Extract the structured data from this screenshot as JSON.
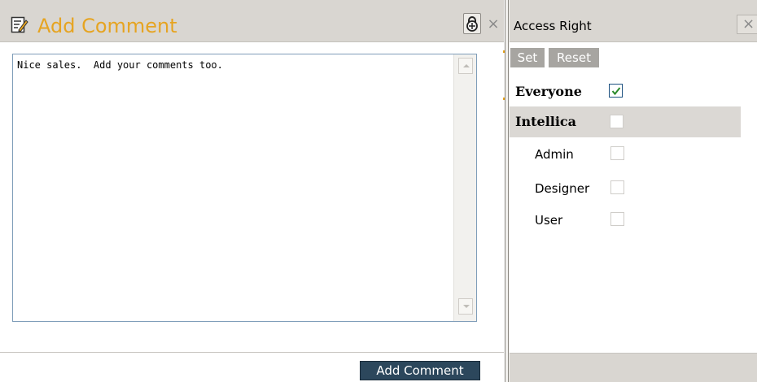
{
  "comment_panel": {
    "title": "Add Comment",
    "icon": "edit-note-icon",
    "lock_icon": "lock-icon",
    "close_label": "×",
    "comment_text": "Nice sales.  Add your comments too.",
    "submit_label": "Add Comment"
  },
  "access_panel": {
    "title": "Access Right",
    "close_label": "×",
    "set_label": "Set",
    "reset_label": "Reset",
    "rights": [
      {
        "label": "Everyone",
        "checked": true,
        "bold": true
      },
      {
        "label": "Intellica",
        "checked": false,
        "bold": true
      },
      {
        "label": "Admin",
        "checked": false,
        "bold": false
      },
      {
        "label": "Designer",
        "checked": false,
        "bold": false
      },
      {
        "label": "User",
        "checked": false,
        "bold": false
      }
    ]
  },
  "colors": {
    "title_accent": "#e6a421",
    "titlebar_bg": "#d9d6d1",
    "submit_button_bg": "#2c475c",
    "toolbar_button_bg": "#a7a5a1",
    "check_mark": "#2a8a2a"
  }
}
